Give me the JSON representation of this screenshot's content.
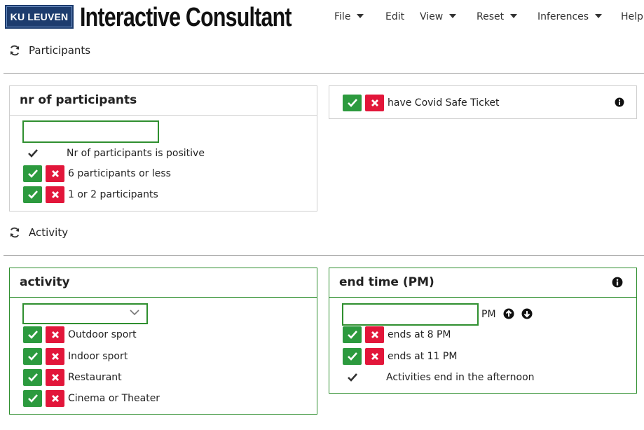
{
  "header": {
    "logo_text": "KU LEUVEN",
    "app_title": "Interactive Consultant",
    "menu": [
      {
        "label": "File",
        "dropdown": true
      },
      {
        "label": "Edit",
        "dropdown": false
      },
      {
        "label": "View",
        "dropdown": true
      },
      {
        "label": "Reset",
        "dropdown": true
      },
      {
        "label": "Inferences",
        "dropdown": true
      },
      {
        "label": "Help",
        "dropdown": false
      }
    ]
  },
  "sections": {
    "participants": {
      "title": "Participants",
      "icon": "refresh-icon"
    },
    "activity": {
      "title": "Activity",
      "icon": "refresh-icon"
    }
  },
  "cards": {
    "nr_participants": {
      "title": "nr of participants",
      "input_value": "",
      "rows": [
        {
          "label": "Nr of participants is positive",
          "state": "derived-true"
        },
        {
          "label": "6 participants or less",
          "state": "choice"
        },
        {
          "label": "1 or 2 participants",
          "state": "choice"
        }
      ]
    },
    "covid": {
      "label": "have Covid Safe Ticket",
      "icon": "info-icon"
    },
    "activity": {
      "title": "activity",
      "select_value": "",
      "rows": [
        {
          "label": "Outdoor sport"
        },
        {
          "label": "Indoor sport"
        },
        {
          "label": "Restaurant"
        },
        {
          "label": "Cinema or Theater"
        }
      ]
    },
    "end_time": {
      "title": "end time (PM)",
      "input_value": "",
      "unit": "PM",
      "rows": [
        {
          "label": "ends at 8 PM",
          "state": "choice"
        },
        {
          "label": "ends at 11 PM",
          "state": "choice"
        },
        {
          "label": "Activities end in the afternoon",
          "state": "derived-true"
        }
      ]
    }
  },
  "colors": {
    "accept": "#2c9a3e",
    "reject": "#e2163a",
    "focus_border": "#2f8f2f",
    "logo_bg": "#1d3c6e"
  }
}
